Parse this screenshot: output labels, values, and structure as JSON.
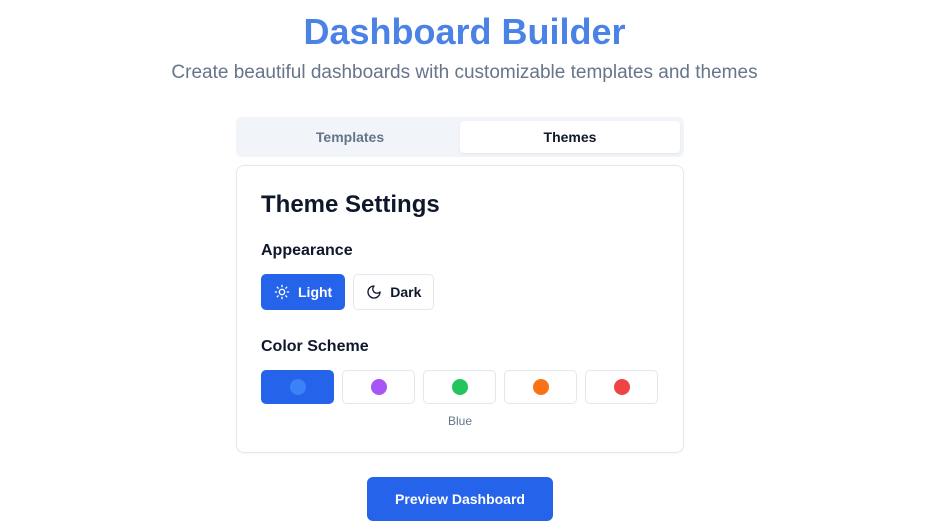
{
  "header": {
    "title": "Dashboard Builder",
    "subtitle": "Create beautiful dashboards with customizable templates and themes"
  },
  "tabs": [
    {
      "label": "Templates",
      "active": false
    },
    {
      "label": "Themes",
      "active": true
    }
  ],
  "theme_settings": {
    "title": "Theme Settings",
    "appearance": {
      "label": "Appearance",
      "options": [
        {
          "label": "Light",
          "icon": "sun-icon",
          "selected": true
        },
        {
          "label": "Dark",
          "icon": "moon-icon",
          "selected": false
        }
      ]
    },
    "color_scheme": {
      "label": "Color Scheme",
      "selected_name": "Blue",
      "swatches": [
        {
          "color": "#3b82f6",
          "selected": true
        },
        {
          "color": "#a855f7",
          "selected": false
        },
        {
          "color": "#22c55e",
          "selected": false
        },
        {
          "color": "#f97316",
          "selected": false
        },
        {
          "color": "#ef4444",
          "selected": false
        }
      ]
    }
  },
  "preview_button": {
    "label": "Preview Dashboard"
  },
  "colors": {
    "title": "#4b82e6",
    "accent": "#2563eb"
  }
}
